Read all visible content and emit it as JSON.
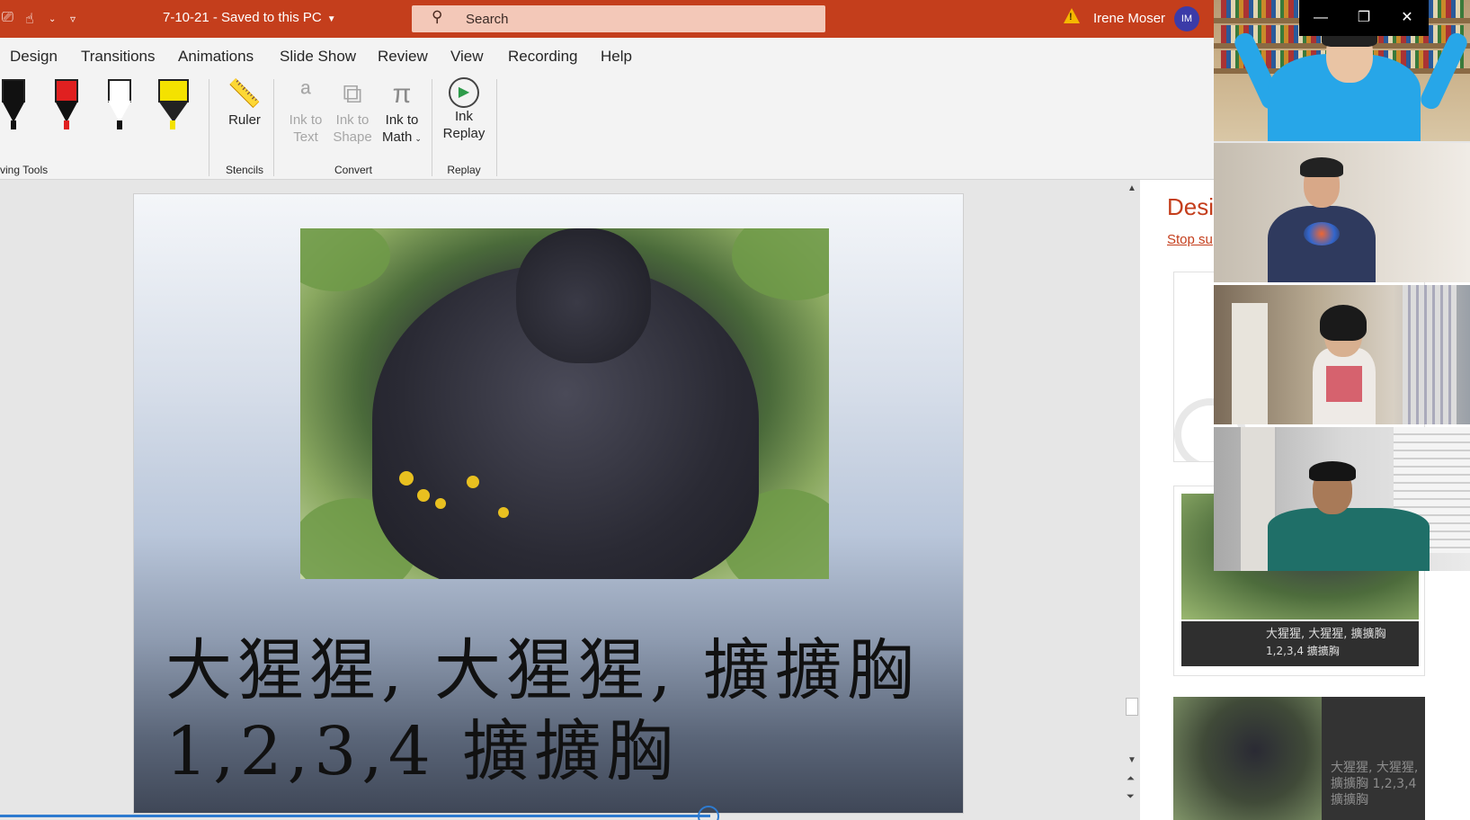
{
  "titlebar": {
    "doc_title": "7-10-21  -  Saved to this PC",
    "search_placeholder": "Search",
    "user_name": "Irene Moser",
    "user_initials": "IM",
    "accent_color": "#c43e1c"
  },
  "menu": {
    "tabs": [
      "Design",
      "Transitions",
      "Animations",
      "Slide Show",
      "Review",
      "View",
      "Recording",
      "Help"
    ]
  },
  "ribbon": {
    "groups": {
      "drawing_tools": "ving Tools",
      "stencils": "Stencils",
      "convert": "Convert",
      "replay": "Replay"
    },
    "buttons": {
      "ruler": "Ruler",
      "ink_to_text_1": "Ink to",
      "ink_to_text_2": "Text",
      "ink_to_shape_1": "Ink to",
      "ink_to_shape_2": "Shape",
      "ink_to_math_1": "Ink to",
      "ink_to_math_2": "Math",
      "ink_replay_1": "Ink",
      "ink_replay_2": "Replay"
    },
    "pens": [
      {
        "name": "black-pen",
        "color": "#111111"
      },
      {
        "name": "red-pen",
        "color": "#e02020"
      },
      {
        "name": "pencil",
        "color": "#ffffff"
      },
      {
        "name": "yellow-highlighter",
        "color": "#f4e200"
      }
    ]
  },
  "slide": {
    "line1": "大猩猩, 大猩猩, 擴擴胸",
    "line2": "1,2,3,4 擴擴胸"
  },
  "designer": {
    "title": "Desi",
    "stop_link": "Stop su",
    "card2_caption_1": "大猩猩, 大猩猩, 擴擴胸",
    "card2_caption_2": "1,2,3,4 擴擴胸",
    "card3_caption": "大猩猩, 大猩猩, 擴擴胸 1,2,3,4 擴擴胸"
  },
  "window_controls": {
    "minimize": "—",
    "restore": "❐",
    "close": "✕"
  }
}
